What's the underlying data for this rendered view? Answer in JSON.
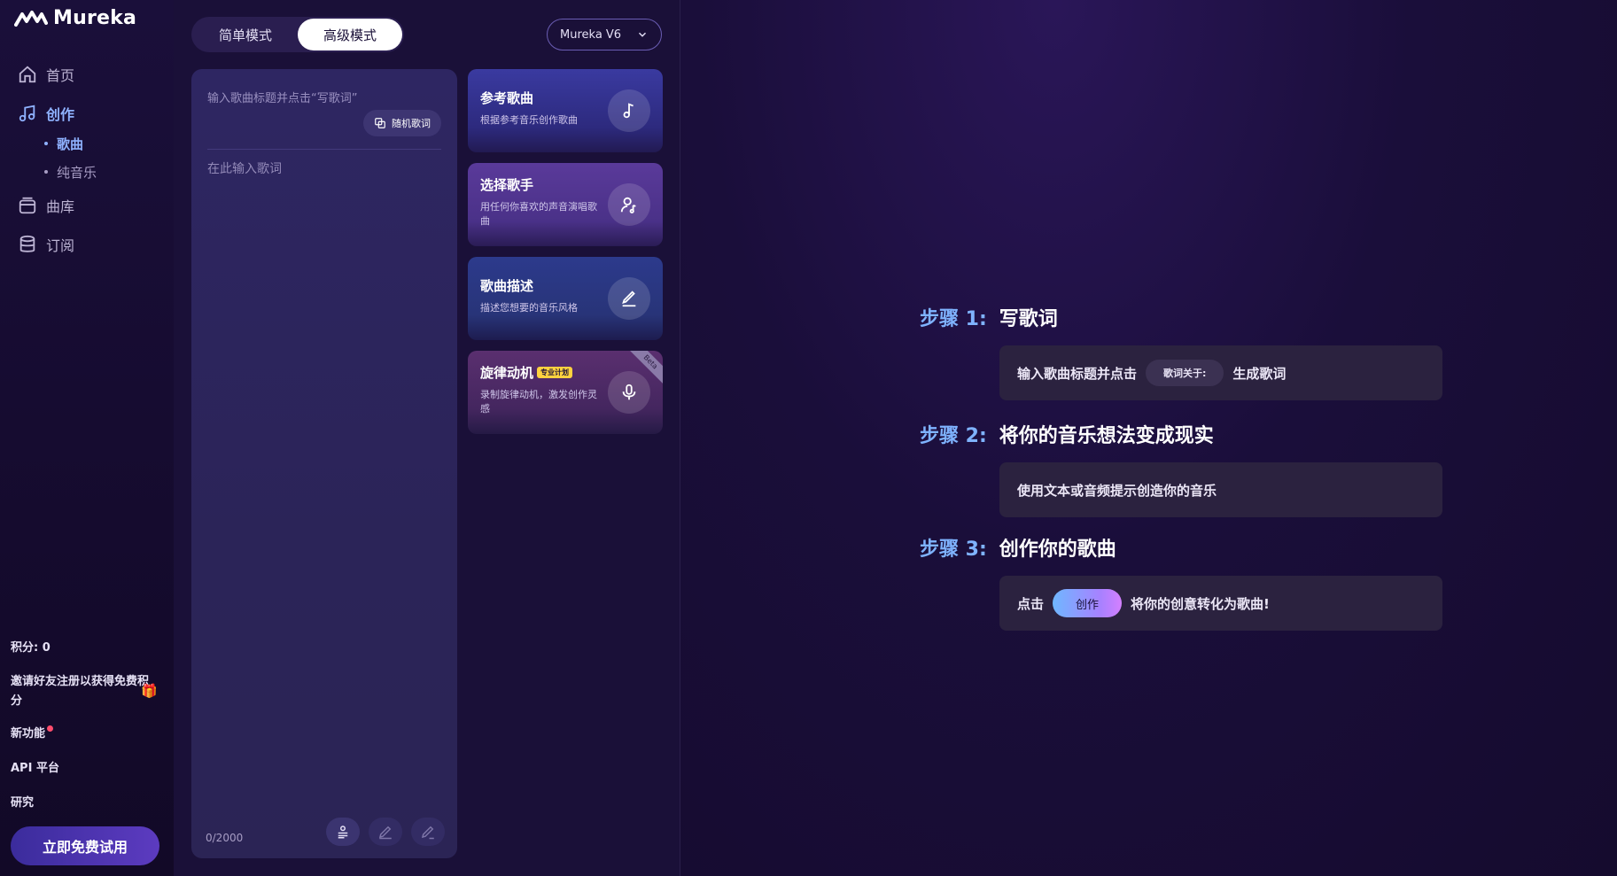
{
  "app": {
    "name": "Mureka"
  },
  "sidebar": {
    "nav": [
      {
        "label": "首页",
        "icon": "home-icon"
      },
      {
        "label": "创作",
        "icon": "music-note-icon"
      },
      {
        "label": "曲库",
        "icon": "library-icon"
      },
      {
        "label": "订阅",
        "icon": "database-icon"
      }
    ],
    "sub_nav": [
      {
        "label": "歌曲"
      },
      {
        "label": "纯音乐"
      }
    ],
    "credits": "积分: 0",
    "invite": "邀请好友注册以获得免费积分",
    "new_features": "新功能",
    "api": "API 平台",
    "research": "研究",
    "trial_button": "立即免费试用"
  },
  "editor": {
    "modes": {
      "simple": "简单模式",
      "advanced": "高级模式"
    },
    "model": "Mureka V6",
    "title_placeholder": "输入歌曲标题并点击“写歌词”",
    "random_lyrics": "随机歌词",
    "lyrics_placeholder": "在此输入歌词",
    "char_count": "0/2000"
  },
  "cards": [
    {
      "title": "参考歌曲",
      "desc": "根据参考音乐创作歌曲",
      "icon": "music-note-icon"
    },
    {
      "title": "选择歌手",
      "desc": "用任何你喜欢的声音演唱歌曲",
      "icon": "singer-icon"
    },
    {
      "title": "歌曲描述",
      "desc": "描述您想要的音乐风格",
      "icon": "pen-icon"
    },
    {
      "title": "旋律动机",
      "badge": "专业计划",
      "ribbon": "Beta",
      "desc": "录制旋律动机，激发创作灵感",
      "icon": "microphone-icon"
    }
  ],
  "guide": {
    "step1": {
      "num": "步骤 1:",
      "title": "写歌词",
      "pre": "输入歌曲标题并点击",
      "pill": "歌词关于:",
      "post": "生成歌词"
    },
    "step2": {
      "num": "步骤 2:",
      "title": "将你的音乐想法变成现实",
      "text": "使用文本或音频提示创造你的音乐"
    },
    "step3": {
      "num": "步骤 3:",
      "title": "创作你的歌曲",
      "pre": "点击",
      "button": "创作",
      "post": "将你的创意转化为歌曲!"
    }
  }
}
